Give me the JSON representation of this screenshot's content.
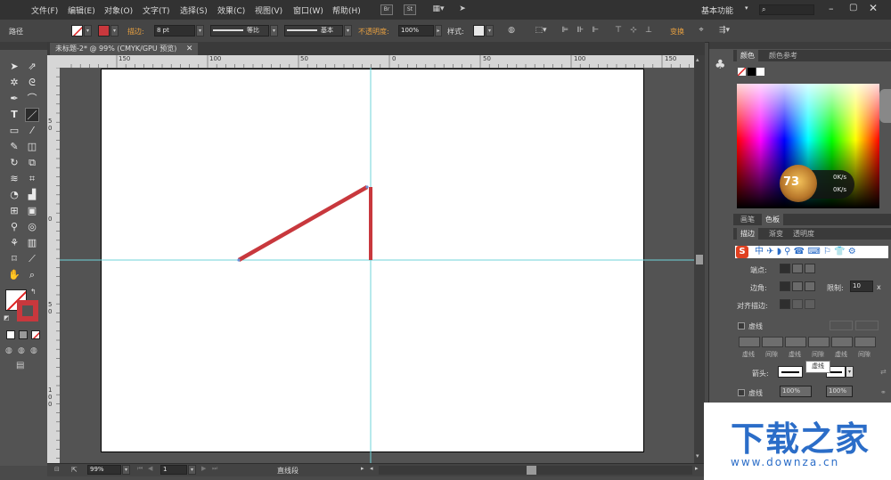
{
  "menu": {
    "items": [
      "文件(F)",
      "编辑(E)",
      "对象(O)",
      "文字(T)",
      "选择(S)",
      "效果(C)",
      "视图(V)",
      "窗口(W)",
      "帮助(H)"
    ],
    "br_label": "Br",
    "st_label": "St",
    "workspace": "基本功能",
    "search_icon": "search-icon"
  },
  "control": {
    "object_type": "路径",
    "stroke_label": "描边:",
    "stroke_weight": "8 pt",
    "profile_label": "等比",
    "brush_label": "基本",
    "opacity_label": "不透明度:",
    "opacity_value": "100%",
    "style_label": "样式:",
    "transform_label": "变换"
  },
  "document": {
    "tab_title": "未标题-2* @ 99% (CMYK/GPU 预览)"
  },
  "ruler": {
    "h_ticks": [
      "150",
      "100",
      "50",
      "0",
      "50",
      "100",
      "150"
    ],
    "v_ticks": [
      "5",
      "0",
      "0",
      "5",
      "0",
      "1",
      "0",
      "0"
    ]
  },
  "status": {
    "zoom": "99%",
    "artboard": "1",
    "tool_name": "直线段"
  },
  "panels": {
    "color_tabs": [
      "颜色",
      "颜色参考"
    ],
    "swatch_tabs": [
      "画笔",
      "色板"
    ],
    "stroke_tabs": [
      "描边",
      "渐变",
      "透明度"
    ],
    "net_up": "0K/s",
    "net_down": "0K/s",
    "badge_number": "73",
    "cap_label": "端点:",
    "corner_label": "边角:",
    "limit_label": "限制:",
    "limit_value": "10",
    "limit_unit": "x",
    "align_label": "对齐描边:",
    "dash_label": "虚线",
    "dash_cols": [
      "虚线",
      "间隙",
      "虚线",
      "间隙",
      "虚线",
      "间隙"
    ],
    "arrow_label": "箭头:",
    "tooltip": "虚线",
    "dash2_label": "虚线",
    "scale1": "100%",
    "scale2": "100%"
  },
  "watermark": {
    "title": "下载之家",
    "url": "www.downza.cn"
  },
  "colors": {
    "stroke_red": "#c8383d",
    "guide": "#6fd3d8",
    "brand_blue": "#2b6dc8"
  }
}
